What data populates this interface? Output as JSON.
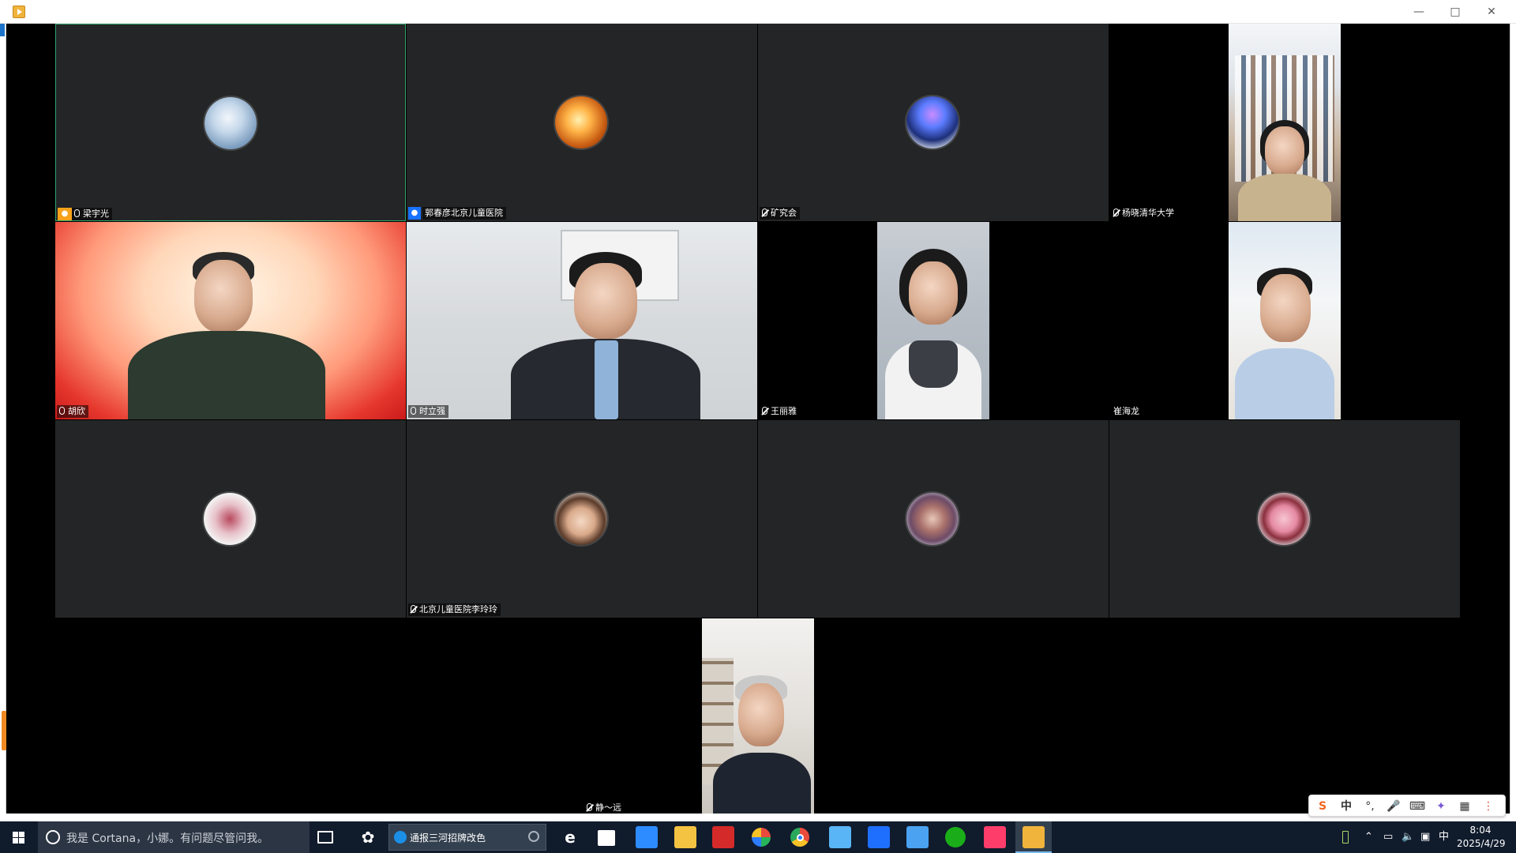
{
  "taskbar": {
    "search_placeholder": "我是 Cortana，小娜。有问题尽管问我。",
    "active_task": "通报三河招牌改色",
    "clock_time": "8:04",
    "clock_date": "2025/4/29",
    "tray_ime": "中"
  },
  "ime": {
    "logo": "S",
    "mode": "中"
  },
  "participants": [
    {
      "name": "梁宇光",
      "avatar": "anime-girl-avatar",
      "role": "host",
      "mic": "on"
    },
    {
      "name": "郭春彦北京儿童医院",
      "avatar": "candle-avatar",
      "role": "cohost",
      "mic": "none"
    },
    {
      "name": "矿究会",
      "avatar": "aurora-avatar",
      "mic": "muted"
    },
    {
      "name": "杨晓清华大学",
      "mic": "muted",
      "video": true
    },
    {
      "name": "胡欣",
      "mic": "on",
      "video": true
    },
    {
      "name": "时立强",
      "mic": "on",
      "video": true
    },
    {
      "name": "王丽雅",
      "mic": "muted",
      "video": true
    },
    {
      "name": "崔海龙",
      "mic": "none",
      "video": true
    },
    {
      "name": "",
      "avatar": "flower-avatar",
      "mic": "none"
    },
    {
      "name": "北京儿童医院李玲玲",
      "avatar": "woman-avatar",
      "mic": "muted"
    },
    {
      "name": "",
      "avatar": "girl-avatar",
      "mic": "none"
    },
    {
      "name": "",
      "avatar": "blossom-avatar",
      "mic": "none"
    },
    {
      "name": "静～远",
      "mic": "muted",
      "video": true
    }
  ],
  "colors": {
    "tile_bg": "#242526",
    "active_border": "#2ea66d",
    "host_badge": "#f7a21b",
    "cohost_badge": "#1772ff",
    "taskbar_bg": "#101b2c"
  }
}
